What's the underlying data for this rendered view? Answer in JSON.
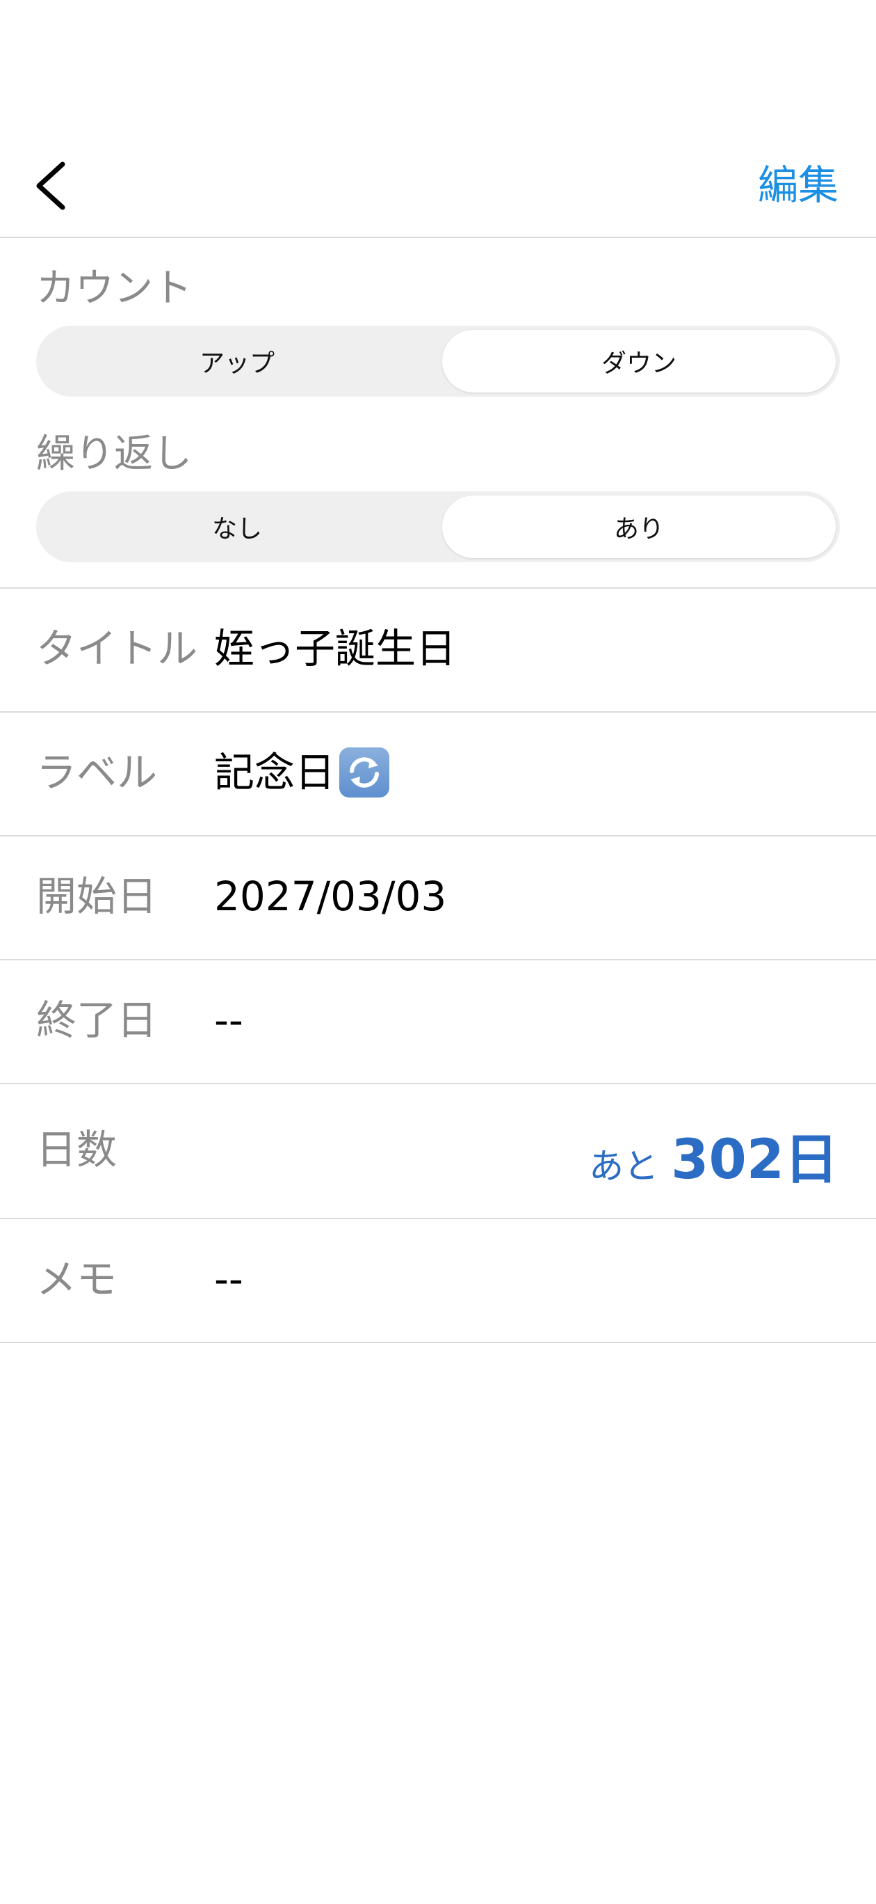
{
  "nav": {
    "back_icon": "chevron-left-icon",
    "edit_label": "編集"
  },
  "count": {
    "label": "カウント",
    "options": [
      "アップ",
      "ダウン"
    ],
    "selected": "ダウン"
  },
  "repeat": {
    "label": "繰り返し",
    "options": [
      "なし",
      "あり"
    ],
    "selected": "あり"
  },
  "rows": {
    "title": {
      "label": "タイトル",
      "value": "姪っ子誕生日"
    },
    "tag": {
      "label": "ラベル",
      "value": "記念日",
      "icon": "repeat-icon"
    },
    "start_date": {
      "label": "開始日",
      "value": "2027/03/03"
    },
    "end_date": {
      "label": "終了日",
      "value": "--"
    },
    "days": {
      "label": "日数",
      "prefix": "あと",
      "value": "302日"
    },
    "memo": {
      "label": "メモ",
      "value": "--"
    }
  },
  "colors": {
    "accent": "#1a8fe3",
    "days_value": "#2b6cc4",
    "label_gray": "#8a8a8a",
    "segment_bg": "#efefef"
  }
}
